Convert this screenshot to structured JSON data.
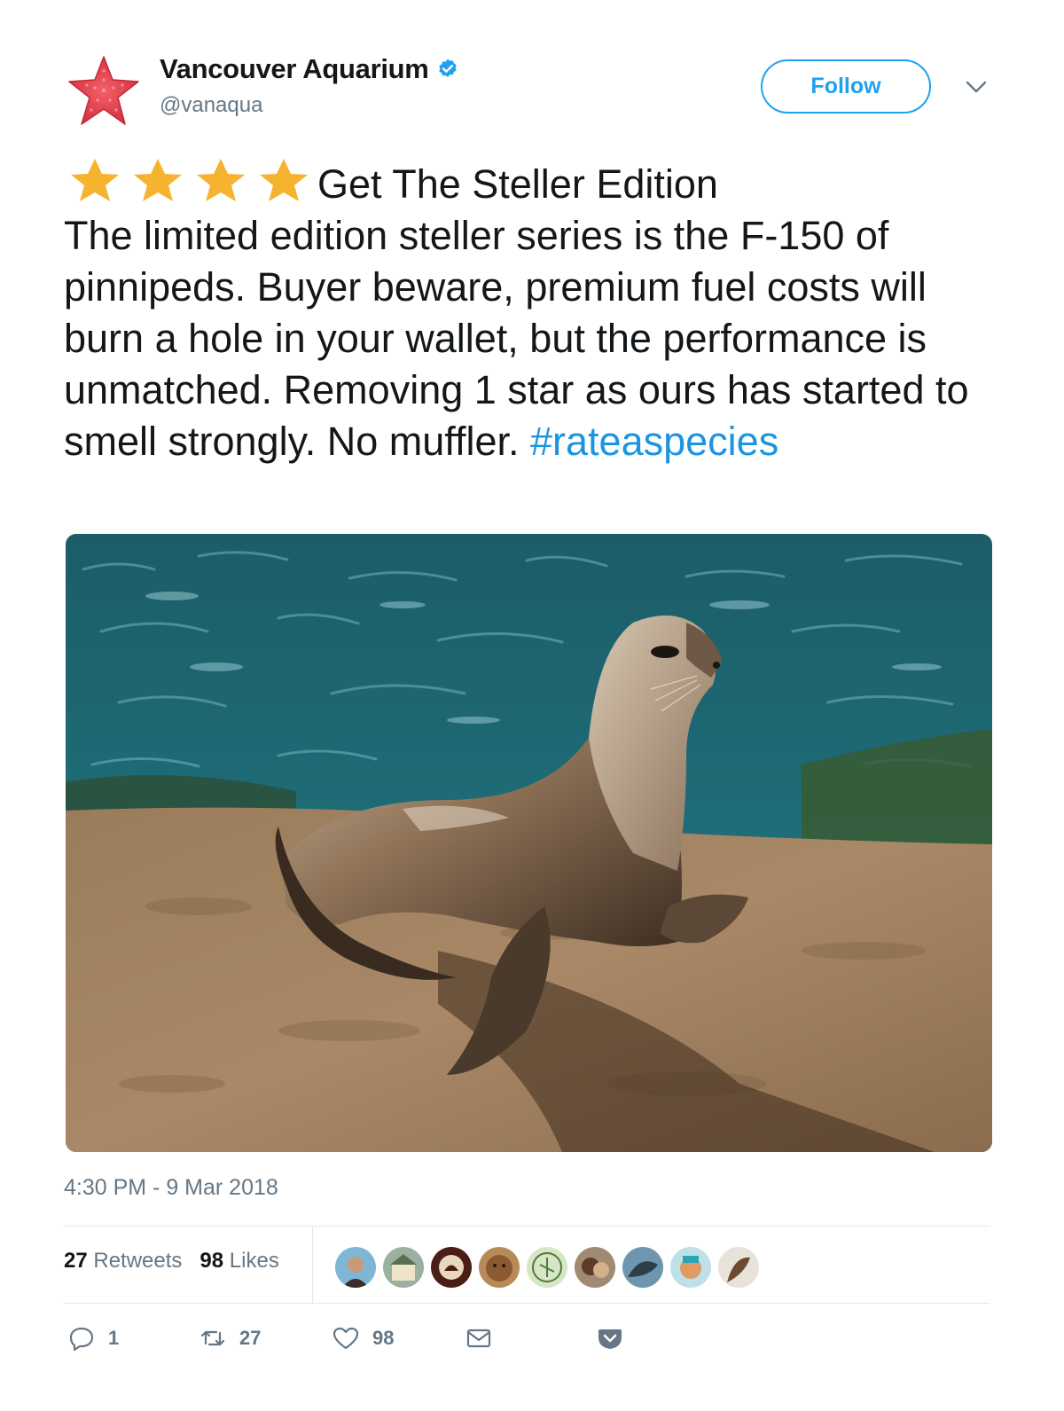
{
  "header": {
    "display_name": "Vancouver Aquarium",
    "handle": "@vanaqua",
    "follow_label": "Follow",
    "avatar_icon": "red-starfish-logo",
    "verified_icon": "verified-badge-icon",
    "menu_icon": "chevron-down-icon"
  },
  "tweet": {
    "rating": {
      "value": 4,
      "max": 5,
      "icon": "star-icon",
      "color": "#f5b330"
    },
    "headline": "Get The Steller Edition",
    "body": "The limited edition steller series is the F-150 of pinnipeds. Buyer beware, premium fuel costs will burn a hole in your wallet, but the performance is unmatched. Removing 1 star as ours has started to smell strongly. No muffler. ",
    "hashtag": "#rateaspecies",
    "timestamp": "4:30 PM - 9 Mar 2018"
  },
  "stats": {
    "retweets_count": "27",
    "retweets_label": "Retweets",
    "likes_count": "98",
    "likes_label": "Likes",
    "liker_avatars": 9
  },
  "actions": {
    "reply_count": "1",
    "retweet_count": "27",
    "like_count": "98"
  },
  "colors": {
    "link": "#1b95e0",
    "follow": "#1da1f2",
    "muted": "#657786",
    "star": "#f5b330"
  }
}
